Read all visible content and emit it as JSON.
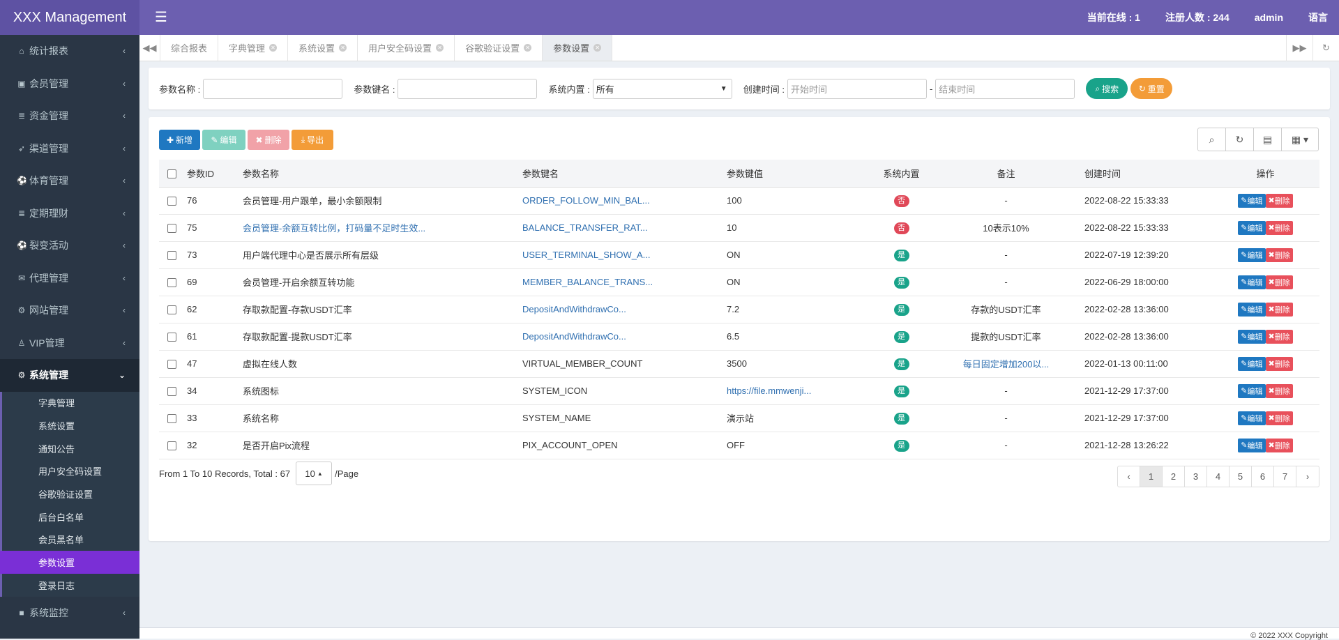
{
  "app": {
    "title": "XXX Management",
    "online_label": "当前在线 : 1",
    "registered_label": "注册人数 : 244",
    "user": "admin",
    "language": "语言"
  },
  "sidebar": {
    "items": [
      {
        "icon": "home-icon",
        "glyph": "⌂",
        "label": "统计报表"
      },
      {
        "icon": "id-card-icon",
        "glyph": "▣",
        "label": "会员管理"
      },
      {
        "icon": "database-icon",
        "glyph": "≣",
        "label": "资金管理"
      },
      {
        "icon": "rocket-icon",
        "glyph": "➶",
        "label": "渠道管理"
      },
      {
        "icon": "soccer-ball-icon",
        "glyph": "⚽",
        "label": "体育管理"
      },
      {
        "icon": "database-icon",
        "glyph": "≣",
        "label": "定期理财"
      },
      {
        "icon": "soccer-ball-icon",
        "glyph": "⚽",
        "label": "裂变活动"
      },
      {
        "icon": "envelope-icon",
        "glyph": "✉",
        "label": "代理管理"
      },
      {
        "icon": "cogs-icon",
        "glyph": "⚙",
        "label": "网站管理"
      },
      {
        "icon": "user-icon",
        "glyph": "♙",
        "label": "VIP管理"
      }
    ],
    "open_item": {
      "icon": "gear-icon",
      "glyph": "⚙",
      "label": "系统管理"
    },
    "sub_items": [
      "字典管理",
      "系统设置",
      "通知公告",
      "用户安全码设置",
      "谷歌验证设置",
      "后台白名单",
      "会员黑名单",
      "参数设置",
      "登录日志"
    ],
    "active_sub": "参数设置",
    "bottom_item": {
      "icon": "video-icon",
      "glyph": "■",
      "label": "系统监控"
    }
  },
  "tabs": [
    "综合报表",
    "字典管理",
    "系统设置",
    "用户安全码设置",
    "谷歌验证设置",
    "参数设置"
  ],
  "search": {
    "name_label": "参数名称 :",
    "key_label": "参数键名 :",
    "builtin_label": "系统内置 :",
    "builtin_value": "所有",
    "time_label": "创建时间 :",
    "start_placeholder": "开始时间",
    "dash": "-",
    "end_placeholder": "结束时间",
    "search_btn": "搜索",
    "reset_btn": "重置"
  },
  "toolbar": {
    "add": "新增",
    "edit": "编辑",
    "delete": "删除",
    "export": "导出"
  },
  "table": {
    "headers": [
      "参数ID",
      "参数名称",
      "参数键名",
      "参数键值",
      "系统内置",
      "备注",
      "创建时间",
      "操作"
    ],
    "rows": [
      {
        "id": "76",
        "name": "会员管理-用户跟单，最小余额限制",
        "name_link": false,
        "key": "ORDER_FOLLOW_MIN_BAL...",
        "key_link": true,
        "value": "100",
        "value_link": false,
        "builtin": "否",
        "remark": "-",
        "remark_link": false,
        "created": "2022-08-22 15:33:33"
      },
      {
        "id": "75",
        "name": "会员管理-余额互转比例，打码量不足时生效...",
        "name_link": true,
        "key": "BALANCE_TRANSFER_RAT...",
        "key_link": true,
        "value": "10",
        "value_link": false,
        "builtin": "否",
        "remark": "10表示10%",
        "remark_link": false,
        "created": "2022-08-22 15:33:33"
      },
      {
        "id": "73",
        "name": "用户端代理中心是否展示所有层级",
        "name_link": false,
        "key": "USER_TERMINAL_SHOW_A...",
        "key_link": true,
        "value": "ON",
        "value_link": false,
        "builtin": "是",
        "remark": "-",
        "remark_link": false,
        "created": "2022-07-19 12:39:20"
      },
      {
        "id": "69",
        "name": "会员管理-开启余额互转功能",
        "name_link": false,
        "key": "MEMBER_BALANCE_TRANS...",
        "key_link": true,
        "value": "ON",
        "value_link": false,
        "builtin": "是",
        "remark": "-",
        "remark_link": false,
        "created": "2022-06-29 18:00:00"
      },
      {
        "id": "62",
        "name": "存取款配置-存款USDT汇率",
        "name_link": false,
        "key": "DepositAndWithdrawCo...",
        "key_link": true,
        "value": "7.2",
        "value_link": false,
        "builtin": "是",
        "remark": "存款的USDT汇率",
        "remark_link": false,
        "created": "2022-02-28 13:36:00"
      },
      {
        "id": "61",
        "name": "存取款配置-提款USDT汇率",
        "name_link": false,
        "key": "DepositAndWithdrawCo...",
        "key_link": true,
        "value": "6.5",
        "value_link": false,
        "builtin": "是",
        "remark": "提款的USDT汇率",
        "remark_link": false,
        "created": "2022-02-28 13:36:00"
      },
      {
        "id": "47",
        "name": "虚拟在线人数",
        "name_link": false,
        "key": "VIRTUAL_MEMBER_COUNT",
        "key_link": false,
        "value": "3500",
        "value_link": false,
        "builtin": "是",
        "remark": "每日固定增加200以...",
        "remark_link": true,
        "created": "2022-01-13 00:11:00"
      },
      {
        "id": "34",
        "name": "系统图标",
        "name_link": false,
        "key": "SYSTEM_ICON",
        "key_link": false,
        "value": "https://file.mmwenji...",
        "value_link": true,
        "builtin": "是",
        "remark": "-",
        "remark_link": false,
        "created": "2021-12-29 17:37:00"
      },
      {
        "id": "33",
        "name": "系统名称",
        "name_link": false,
        "key": "SYSTEM_NAME",
        "key_link": false,
        "value": "演示站",
        "value_link": false,
        "builtin": "是",
        "remark": "-",
        "remark_link": false,
        "created": "2021-12-29 17:37:00"
      },
      {
        "id": "32",
        "name": "是否开启Pix流程",
        "name_link": false,
        "key": "PIX_ACCOUNT_OPEN",
        "key_link": false,
        "value": "OFF",
        "value_link": false,
        "builtin": "是",
        "remark": "-",
        "remark_link": false,
        "created": "2021-12-28 13:26:22"
      }
    ],
    "edit_label": "编辑",
    "delete_label": "删除"
  },
  "pager": {
    "info": "From 1 To 10 Records, Total : 67",
    "page_size": "10",
    "per_page": "/Page",
    "prev": "‹",
    "next": "›",
    "pages": [
      "1",
      "2",
      "3",
      "4",
      "5",
      "6",
      "7"
    ],
    "current": "1"
  },
  "footer": {
    "text": "© 2022 XXX Copyright"
  },
  "colors": {
    "header": "#6c5fb0",
    "sidebar": "#2a3645",
    "active_sub": "#7a2fd6",
    "link": "#2f6fb0",
    "badge_no": "#e04858",
    "badge_yes": "#19a38a"
  }
}
